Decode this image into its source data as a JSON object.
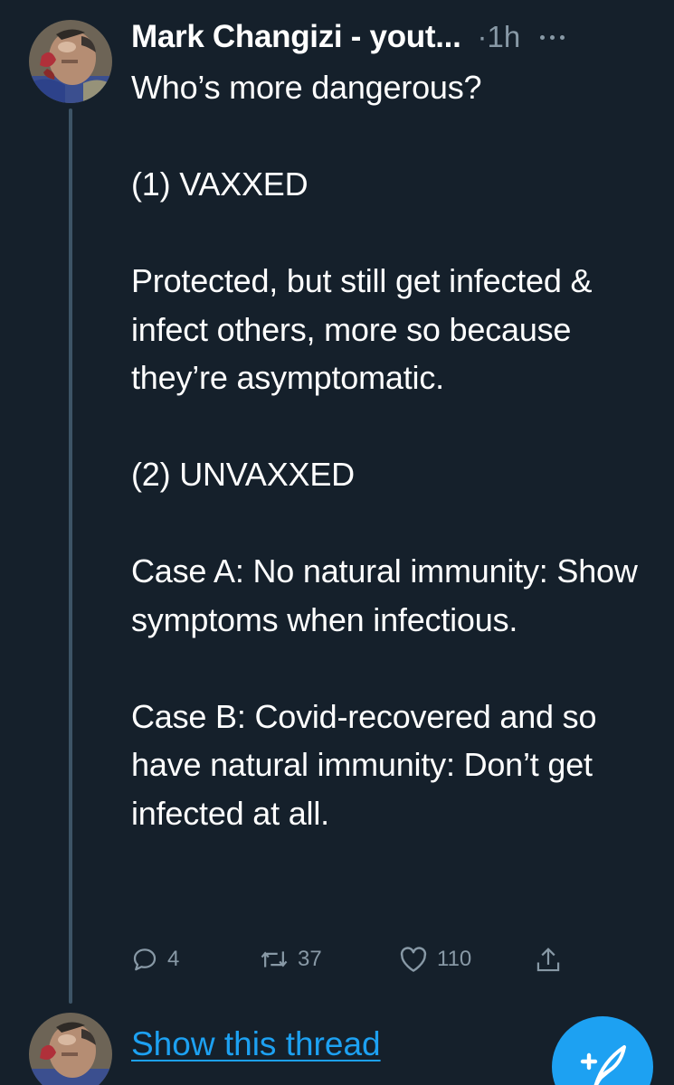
{
  "tweet": {
    "author_name": "Mark Changizi - yout...",
    "time": "·1h",
    "text": "Who’s more dangerous?\n\n(1) VAXXED\n\nProtected, but still get infected & infect others, more so because they’re asymptomatic.\n\n(2) UNVAXXED\n\nCase A: No natural immunity: Show symptoms when infectious.\n\nCase B: Covid-recovered and so have natural immunity: Don’t get infected at all.",
    "actions": {
      "reply_count": "4",
      "retweet_count": "37",
      "like_count": "110"
    }
  },
  "thread": {
    "show_label": "Show this thread"
  },
  "icons": {
    "more": "more-horizontal-icon",
    "reply": "reply-icon",
    "retweet": "retweet-icon",
    "like": "heart-icon",
    "share": "share-icon",
    "compose": "compose-tweet-icon"
  },
  "colors": {
    "background": "#15202b",
    "text": "#ffffff",
    "muted": "#8899a6",
    "accent": "#1da1f2",
    "thread_line": "#3d5466"
  }
}
